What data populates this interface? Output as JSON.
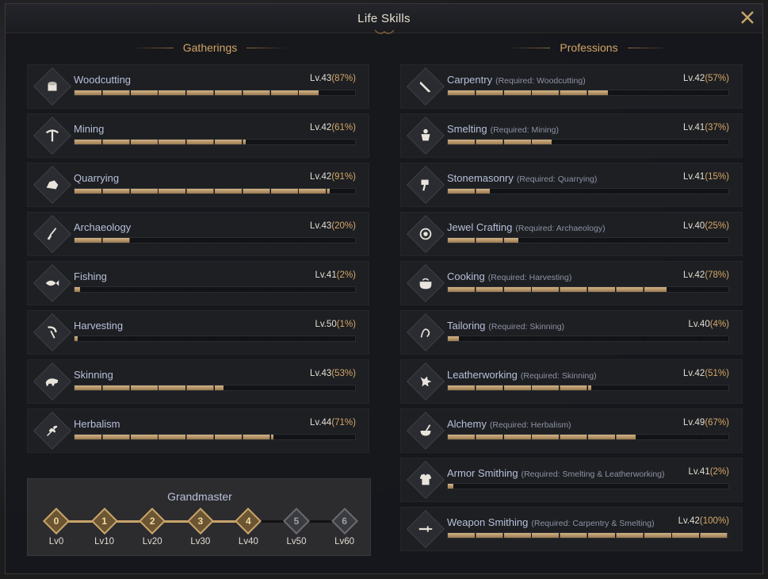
{
  "window": {
    "title": "Life Skills",
    "close_icon": "close-x-icon"
  },
  "gatherings": {
    "heading": "Gatherings",
    "items": [
      {
        "name": "Woodcutting",
        "icon": "log-stump-icon",
        "level": "Lv.43",
        "pct": "(87%)",
        "progress": 0.87
      },
      {
        "name": "Mining",
        "icon": "pickaxe-icon",
        "level": "Lv.42",
        "pct": "(61%)",
        "progress": 0.61
      },
      {
        "name": "Quarrying",
        "icon": "rock-ore-icon",
        "level": "Lv.42",
        "pct": "(91%)",
        "progress": 0.91
      },
      {
        "name": "Archaeology",
        "icon": "shovel-icon",
        "level": "Lv.43",
        "pct": "(20%)",
        "progress": 0.2
      },
      {
        "name": "Fishing",
        "icon": "fish-icon",
        "level": "Lv.41",
        "pct": "(2%)",
        "progress": 0.02
      },
      {
        "name": "Harvesting",
        "icon": "sickle-icon",
        "level": "Lv.50",
        "pct": "(1%)",
        "progress": 0.01
      },
      {
        "name": "Skinning",
        "icon": "boar-icon",
        "level": "Lv.43",
        "pct": "(53%)",
        "progress": 0.53
      },
      {
        "name": "Herbalism",
        "icon": "herb-leaf-icon",
        "level": "Lv.44",
        "pct": "(71%)",
        "progress": 0.71
      }
    ]
  },
  "professions": {
    "heading": "Professions",
    "items": [
      {
        "name": "Carpentry",
        "req": "(Required: Woodcutting)",
        "icon": "saw-icon",
        "level": "Lv.42",
        "pct": "(57%)",
        "progress": 0.57
      },
      {
        "name": "Smelting",
        "req": "(Required: Mining)",
        "icon": "crucible-icon",
        "level": "Lv.41",
        "pct": "(37%)",
        "progress": 0.37
      },
      {
        "name": "Stonemasonry",
        "req": "(Required: Quarrying)",
        "icon": "stone-hammer-icon",
        "level": "Lv.41",
        "pct": "(15%)",
        "progress": 0.15
      },
      {
        "name": "Jewel Crafting",
        "req": "(Required: Archaeology)",
        "icon": "gem-ring-icon",
        "level": "Lv.40",
        "pct": "(25%)",
        "progress": 0.25
      },
      {
        "name": "Cooking",
        "req": "(Required: Harvesting)",
        "icon": "cooking-pot-icon",
        "level": "Lv.42",
        "pct": "(78%)",
        "progress": 0.78
      },
      {
        "name": "Tailoring",
        "req": "(Required: Skinning)",
        "icon": "needle-thread-icon",
        "level": "Lv.40",
        "pct": "(4%)",
        "progress": 0.04
      },
      {
        "name": "Leatherworking",
        "req": "(Required: Skinning)",
        "icon": "leather-hide-icon",
        "level": "Lv.42",
        "pct": "(51%)",
        "progress": 0.51
      },
      {
        "name": "Alchemy",
        "req": "(Required: Herbalism)",
        "icon": "mortar-pestle-icon",
        "level": "Lv.49",
        "pct": "(67%)",
        "progress": 0.67
      },
      {
        "name": "Armor Smithing",
        "req": "(Required: Smelting & Leatherworking)",
        "icon": "chest-armor-icon",
        "level": "Lv.41",
        "pct": "(2%)",
        "progress": 0.02
      },
      {
        "name": "Weapon Smithing",
        "req": "(Required: Carpentry & Smelting)",
        "icon": "sword-icon",
        "level": "Lv.42",
        "pct": "(100%)",
        "progress": 1.0
      }
    ]
  },
  "grandmaster": {
    "title": "Grandmaster",
    "progress": 0.65,
    "tiers": [
      {
        "num": "0",
        "label": "Lv0",
        "achieved": true
      },
      {
        "num": "1",
        "label": "Lv10",
        "achieved": true
      },
      {
        "num": "2",
        "label": "Lv20",
        "achieved": true
      },
      {
        "num": "3",
        "label": "Lv30",
        "achieved": true
      },
      {
        "num": "4",
        "label": "Lv40",
        "achieved": true
      },
      {
        "num": "5",
        "label": "Lv50",
        "achieved": false
      },
      {
        "num": "6",
        "label": "Lv60",
        "achieved": false
      }
    ]
  },
  "colors": {
    "accent": "#d2a465",
    "bar": "#c7a67a",
    "name": "#b8c0d8"
  }
}
